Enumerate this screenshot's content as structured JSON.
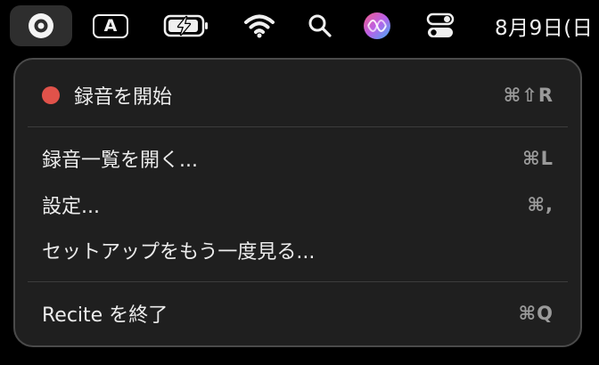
{
  "menubar": {
    "app_icon": "recite-record-icon",
    "input_source": "A",
    "battery_icon": "battery-charging-icon",
    "wifi_icon": "wifi-icon",
    "search_icon": "spotlight-search-icon",
    "siri_icon": "siri-icon",
    "control_center_icon": "control-center-icon",
    "clock": "8月9日(日"
  },
  "menu": {
    "start_recording": {
      "label": "録音を開始",
      "shortcut": "⌘⇧R",
      "dot_color": "#e0524a"
    },
    "open_list": {
      "label": "録音一覧を開く...",
      "shortcut": "⌘L"
    },
    "settings": {
      "label": "設定...",
      "shortcut": "⌘,"
    },
    "setup": {
      "label": "セットアップをもう一度見る..."
    },
    "quit": {
      "label": "Recite を終了",
      "shortcut": "⌘Q"
    }
  }
}
